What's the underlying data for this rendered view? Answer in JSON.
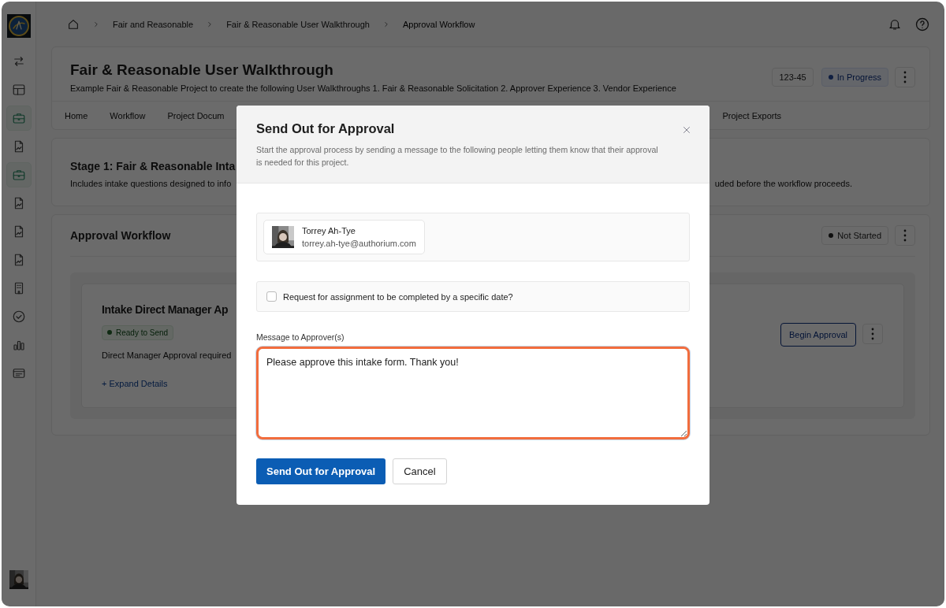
{
  "sidebar": {
    "items": [
      {
        "kind": "swap",
        "active": false
      },
      {
        "kind": "layout",
        "active": false
      },
      {
        "kind": "briefcase",
        "active": true
      },
      {
        "kind": "document",
        "active": false
      },
      {
        "kind": "briefcase",
        "active": true
      },
      {
        "kind": "document",
        "active": false
      },
      {
        "kind": "document",
        "active": false
      },
      {
        "kind": "document",
        "active": false
      },
      {
        "kind": "grid",
        "active": false
      },
      {
        "kind": "check",
        "active": false
      },
      {
        "kind": "chart",
        "active": false
      },
      {
        "kind": "list",
        "active": false
      }
    ]
  },
  "breadcrumb": [
    "Fair and Reasonable",
    "Fair & Reasonable User Walkthrough",
    "Approval Workflow"
  ],
  "project": {
    "title": "Fair & Reasonable User Walkthrough",
    "description": "Example Fair & Reasonable Project to create the following User Walkthroughs 1. Fair & Reasonable Solicitation 2. Approver Experience 3. Vendor Experience",
    "id": "123-45",
    "status": "In Progress"
  },
  "tabs": [
    {
      "label": "Home"
    },
    {
      "label": "Workflow"
    },
    {
      "label": "Project Docum"
    },
    {
      "label": "Project Exports"
    }
  ],
  "stage": {
    "title": "Stage 1: Fair & Reasonable Inta",
    "description_start": "Includes intake questions designed to info",
    "description_end": "uded before the workflow proceeds."
  },
  "workflow": {
    "title": "Approval Workflow",
    "status": "Not Started",
    "step": {
      "title": "Intake Direct Manager Ap",
      "status": "Ready to Send",
      "description": "Direct Manager Approval required",
      "expand_link": "+ Expand Details",
      "action": "Begin Approval"
    }
  },
  "dialog": {
    "title": "Send Out for Approval",
    "description": "Start the approval process by sending a message to the following people letting them know that their approval is needed for this project.",
    "recipients": [
      {
        "name": "Torrey Ah-Tye",
        "email": "torrey.ah-tye@authorium.com"
      }
    ],
    "due_date_option": {
      "label": "Request for assignment to be completed by a specific date?",
      "checked": false
    },
    "message": {
      "label": "Message to Approver(s)",
      "value": "Please approve this intake form. Thank you!",
      "focused": true
    },
    "buttons": [
      {
        "label": "Send Out for Approval",
        "kind": "primary"
      },
      {
        "label": "Cancel",
        "kind": "secondary"
      }
    ]
  }
}
